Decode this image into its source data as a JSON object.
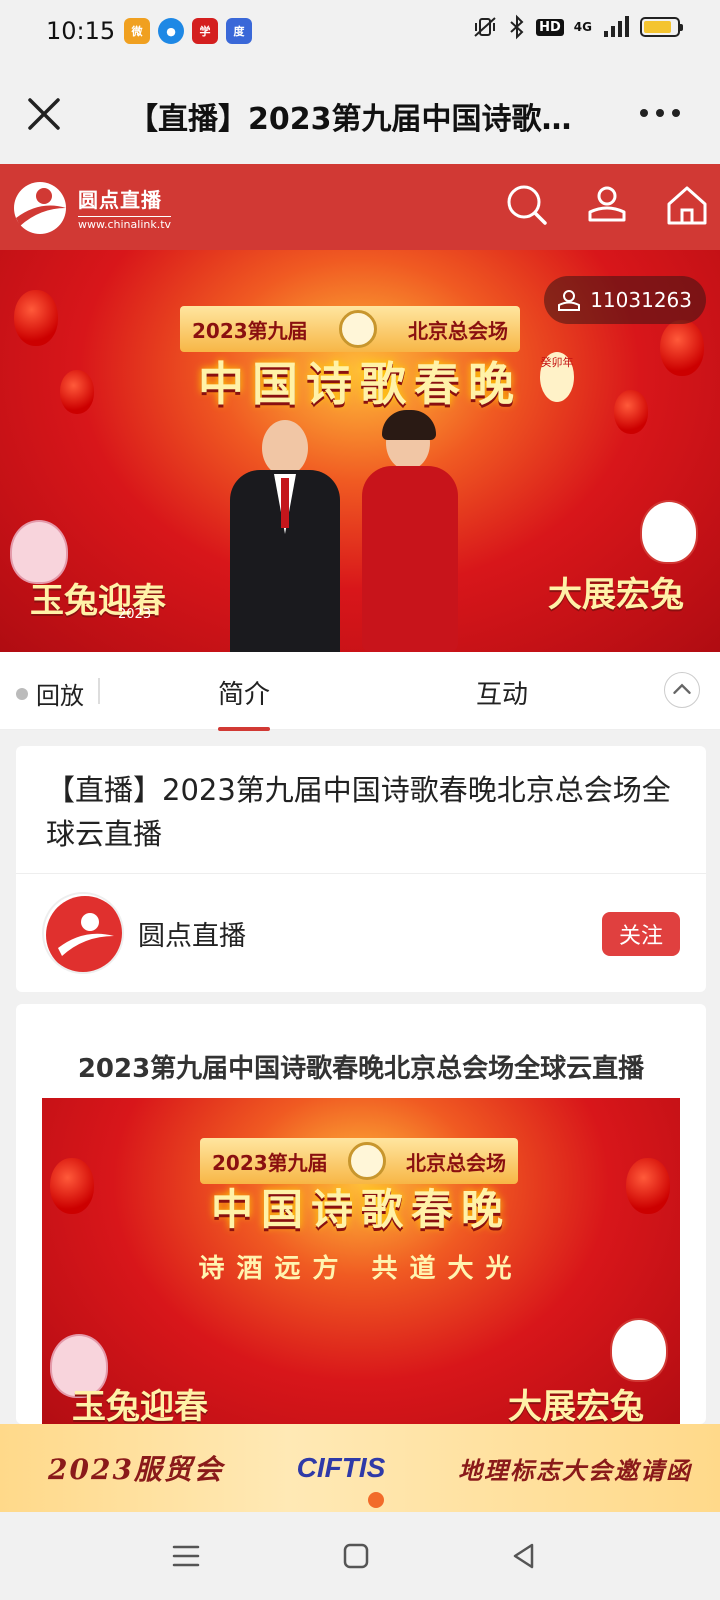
{
  "status_bar": {
    "time": "10:15",
    "app_icons": [
      {
        "name": "weibo-icon",
        "color": "#f0a020"
      },
      {
        "name": "browser-icon",
        "color": "#1e88e5"
      },
      {
        "name": "xuexi-icon",
        "color": "#d41f1f"
      },
      {
        "name": "baidu-icon",
        "color": "#3a68d8"
      }
    ],
    "hd_label": "HD",
    "network": "4G",
    "battery_level": 0.85,
    "battery_color": "#f4c430"
  },
  "title_bar": {
    "title": "【直播】2023第九届中国诗歌春晚北京总会场全球云直播",
    "close_icon": "close-icon",
    "more_icon": "more-icon"
  },
  "site_header": {
    "logo_name": "圆点直播",
    "logo_url": "www.chinalink.tv",
    "brand_color": "#d13934",
    "icons": [
      "search-icon",
      "user-icon",
      "home-icon"
    ]
  },
  "video": {
    "viewer_count": "11031263",
    "banner_top_left": "2023第九届",
    "banner_top_right": "北京总会场",
    "banner_main": "中国诗歌春晚",
    "badge_year": "癸卯年",
    "deco_left": "玉兔迎春",
    "deco_left_sub": "2023",
    "deco_right": "大展宏兔"
  },
  "tabs": {
    "replay": "回放",
    "intro": "简介",
    "interact": "互动",
    "active": "简介"
  },
  "intro_card": {
    "title": "【直播】2023第九届中国诗歌春晚北京总会场全球云直播",
    "channel_name": "圆点直播",
    "follow_label": "关注"
  },
  "article": {
    "title": "2023第九届中国诗歌春晚北京总会场全球云直播",
    "poster_top_left": "2023第九届",
    "poster_top_right": "北京总会场",
    "poster_main": "中国诗歌春晚",
    "poster_slogan": "诗酒远方 共道大光",
    "poster_deco_left": "玉兔迎春",
    "poster_deco_right": "大展宏兔"
  },
  "ad": {
    "left_text": "2023服贸会",
    "logo_text": "CIFTIS",
    "right_text": "地理标志大会邀请函"
  },
  "nav": {
    "icons": [
      "menu-icon",
      "home-square-icon",
      "back-icon"
    ]
  }
}
